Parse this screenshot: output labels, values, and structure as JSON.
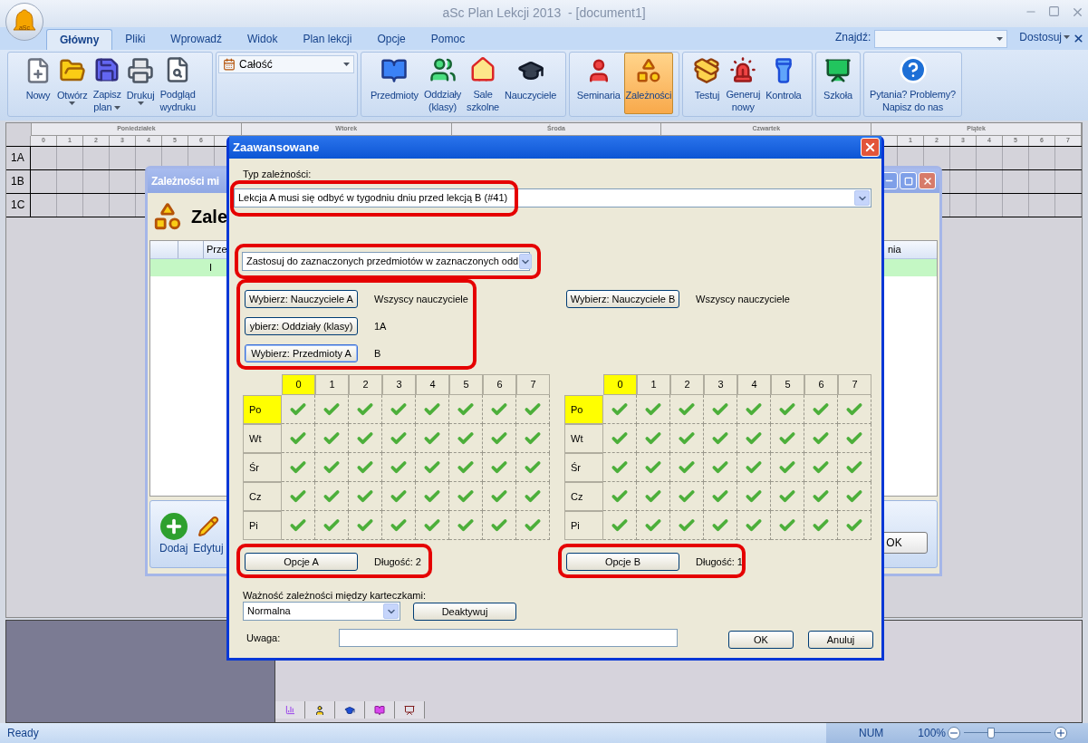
{
  "window": {
    "title": "aSc Plan Lekcji 2013  - [document1]",
    "logo": "aSc"
  },
  "ribbon_tabs": [
    {
      "label": "Główny",
      "selected": true
    },
    {
      "label": "Pliki",
      "selected": false
    },
    {
      "label": "Wprowadź",
      "selected": false
    },
    {
      "label": "Widok",
      "selected": false
    },
    {
      "label": "Plan lekcji",
      "selected": false
    },
    {
      "label": "Opcje",
      "selected": false
    },
    {
      "label": "Pomoc",
      "selected": false
    }
  ],
  "search": {
    "label": "Znajdź:"
  },
  "customize": {
    "label": "Dostosuj"
  },
  "ribbon_groups": [
    {
      "items": [
        {
          "kind": "button",
          "lines": [
            "Nowy"
          ],
          "dropdown": false,
          "selected": false
        },
        {
          "kind": "button",
          "lines": [
            "Otwórz"
          ],
          "dropdown": true,
          "selected": false
        },
        {
          "kind": "button",
          "lines": [
            "Zapisz",
            "plan"
          ],
          "dropdown": true,
          "selected": false
        },
        {
          "kind": "button",
          "lines": [
            "Drukuj"
          ],
          "dropdown": true,
          "selected": false
        },
        {
          "kind": "button",
          "lines": [
            "Podgląd",
            "wydruku"
          ],
          "dropdown": false,
          "selected": false
        }
      ]
    },
    {
      "items": [
        {
          "kind": "combo",
          "value": "Całość"
        }
      ]
    },
    {
      "items": [
        {
          "kind": "button",
          "lines": [
            "Przedmioty"
          ],
          "dropdown": false,
          "selected": false
        },
        {
          "kind": "button",
          "lines": [
            "Oddziały",
            "(klasy)"
          ],
          "dropdown": false,
          "selected": false
        },
        {
          "kind": "button",
          "lines": [
            "Sale",
            "szkolne"
          ],
          "dropdown": false,
          "selected": false
        },
        {
          "kind": "button",
          "lines": [
            "Nauczyciele"
          ],
          "dropdown": false,
          "selected": false
        }
      ]
    },
    {
      "items": [
        {
          "kind": "button",
          "lines": [
            "Seminaria"
          ],
          "dropdown": false,
          "selected": false
        },
        {
          "kind": "button",
          "lines": [
            "Zależności"
          ],
          "dropdown": false,
          "selected": true
        }
      ]
    },
    {
      "items": [
        {
          "kind": "button",
          "lines": [
            "Testuj"
          ],
          "dropdown": false,
          "selected": false
        },
        {
          "kind": "button",
          "lines": [
            "Generuj",
            "nowy"
          ],
          "dropdown": false,
          "selected": false
        },
        {
          "kind": "button",
          "lines": [
            "Kontrola"
          ],
          "dropdown": false,
          "selected": false
        }
      ]
    },
    {
      "items": [
        {
          "kind": "button",
          "lines": [
            "Szkoła"
          ],
          "dropdown": false,
          "selected": false
        }
      ]
    },
    {
      "items": [
        {
          "kind": "button",
          "lines": [
            "Pytania? Problemy?",
            "Napisz do nas"
          ],
          "dropdown": false,
          "selected": false
        }
      ]
    }
  ],
  "timetable": {
    "days": [
      {
        "name": "Poniedziałek",
        "periods": [
          "0",
          "1",
          "2",
          "3",
          "4",
          "5",
          "6"
        ]
      },
      {
        "name": "Wtorek"
      },
      {
        "name": "Środa"
      },
      {
        "name": "Czwartek"
      },
      {
        "name": "Piątek",
        "periods": [
          "1",
          "2",
          "3",
          "4",
          "5",
          "6",
          "7"
        ]
      }
    ],
    "classes": [
      "1A",
      "1B",
      "1C"
    ]
  },
  "background_dialog": {
    "title": "Zależności mi",
    "heading": "Zale",
    "columns": [
      "Prze",
      "nia"
    ],
    "rows": [
      {
        "cells": [
          "I"
        ],
        "selected": true
      }
    ],
    "toolbar": [
      "Dodaj",
      "Edytuj"
    ],
    "ok": "OK"
  },
  "dialog": {
    "title": "Zaawansowane",
    "type_label": "Typ zależności:",
    "type_combo": {
      "value": "Lekcja A musi się odbyć w tygodniu dniu przed lekcją B (#41)",
      "highlighted": true
    },
    "scope_combo": {
      "value": "Zastosuj do zaznaczonych przedmiotów w zaznaczonych odd",
      "highlighted": true
    },
    "selectors": [
      {
        "highlighted": true,
        "rows": [
          {
            "button": "Wybierz: Nauczyciele A",
            "value": "Wszyscy nauczyciele",
            "focused": false
          },
          {
            "button": "ybierz: Oddziały (klasy)",
            "value": "1A",
            "focused": false
          },
          {
            "button": "Wybierz: Przedmioty A",
            "value": "B",
            "focused": true
          }
        ]
      },
      {
        "rows": [
          {
            "button": "Wybierz: Nauczyciele B",
            "value": "Wszyscy nauczyciele",
            "focused": false
          }
        ]
      }
    ],
    "grids": [
      {
        "periods": [
          {
            "label": "0",
            "selected": true
          },
          {
            "label": "1",
            "selected": false
          },
          {
            "label": "2",
            "selected": false
          },
          {
            "label": "3",
            "selected": false
          },
          {
            "label": "4",
            "selected": false
          },
          {
            "label": "5",
            "selected": false
          },
          {
            "label": "6",
            "selected": false
          },
          {
            "label": "7",
            "selected": false
          }
        ],
        "days": [
          {
            "label": "Po",
            "selected": true,
            "checked": [
              true,
              true,
              true,
              true,
              true,
              true,
              true,
              true
            ]
          },
          {
            "label": "Wt",
            "selected": false,
            "checked": [
              true,
              true,
              true,
              true,
              true,
              true,
              true,
              true
            ]
          },
          {
            "label": "Śr",
            "selected": false,
            "checked": [
              true,
              true,
              true,
              true,
              true,
              true,
              true,
              true
            ]
          },
          {
            "label": "Cz",
            "selected": false,
            "checked": [
              true,
              true,
              true,
              true,
              true,
              true,
              true,
              true
            ]
          },
          {
            "label": "Pi",
            "selected": false,
            "checked": [
              true,
              true,
              true,
              true,
              true,
              true,
              true,
              true
            ]
          }
        ]
      },
      {
        "periods": [
          {
            "label": "0",
            "selected": true
          },
          {
            "label": "1",
            "selected": false
          },
          {
            "label": "2",
            "selected": false
          },
          {
            "label": "3",
            "selected": false
          },
          {
            "label": "4",
            "selected": false
          },
          {
            "label": "5",
            "selected": false
          },
          {
            "label": "6",
            "selected": false
          },
          {
            "label": "7",
            "selected": false
          }
        ],
        "days": [
          {
            "label": "Po",
            "selected": true,
            "checked": [
              true,
              true,
              true,
              true,
              true,
              true,
              true,
              true
            ]
          },
          {
            "label": "Wt",
            "selected": false,
            "checked": [
              true,
              true,
              true,
              true,
              true,
              true,
              true,
              true
            ]
          },
          {
            "label": "Śr",
            "selected": false,
            "checked": [
              true,
              true,
              true,
              true,
              true,
              true,
              true,
              true
            ]
          },
          {
            "label": "Cz",
            "selected": false,
            "checked": [
              true,
              true,
              true,
              true,
              true,
              true,
              true,
              true
            ]
          },
          {
            "label": "Pi",
            "selected": false,
            "checked": [
              true,
              true,
              true,
              true,
              true,
              true,
              true,
              true
            ]
          }
        ]
      }
    ],
    "options": [
      {
        "button": "Opcje A",
        "length": "Długość: 2",
        "highlighted": true
      },
      {
        "button": "Opcje B",
        "length": "Długość: 1",
        "highlighted": true
      }
    ],
    "priority": {
      "label": "Ważność zależności między karteczkami:",
      "value": "Normalna"
    },
    "deactivate": "Deaktywuj",
    "note": {
      "label": "Uwaga:"
    },
    "buttons": [
      "OK",
      "Anuluj"
    ]
  },
  "status_bar": {
    "text": "Ready",
    "indicator": "NUM",
    "zoom": {
      "label": "100%",
      "level": 0.31
    }
  }
}
